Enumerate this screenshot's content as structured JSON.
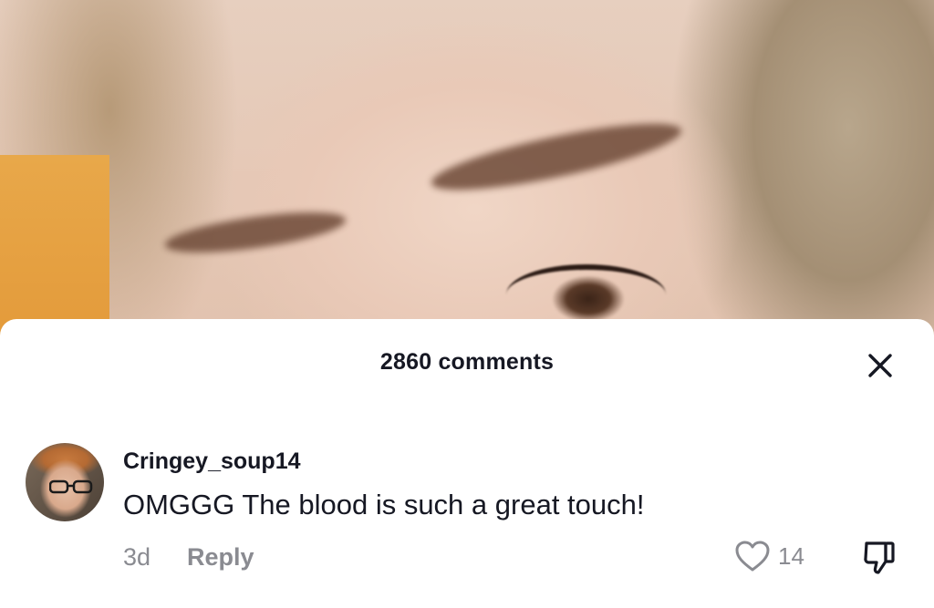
{
  "comments_panel": {
    "count_label": "2860 comments",
    "close_icon": "close-icon"
  },
  "comment": {
    "username": "Cringey_soup14",
    "text": "OMGGG The blood is such a great touch!",
    "timestamp": "3d",
    "reply_label": "Reply",
    "like_count": "14",
    "like_icon": "heart-icon",
    "dislike_icon": "thumbs-down-icon"
  },
  "colors": {
    "text_primary": "#161823",
    "text_secondary": "#8a8b91",
    "sheet_background": "#ffffff"
  }
}
